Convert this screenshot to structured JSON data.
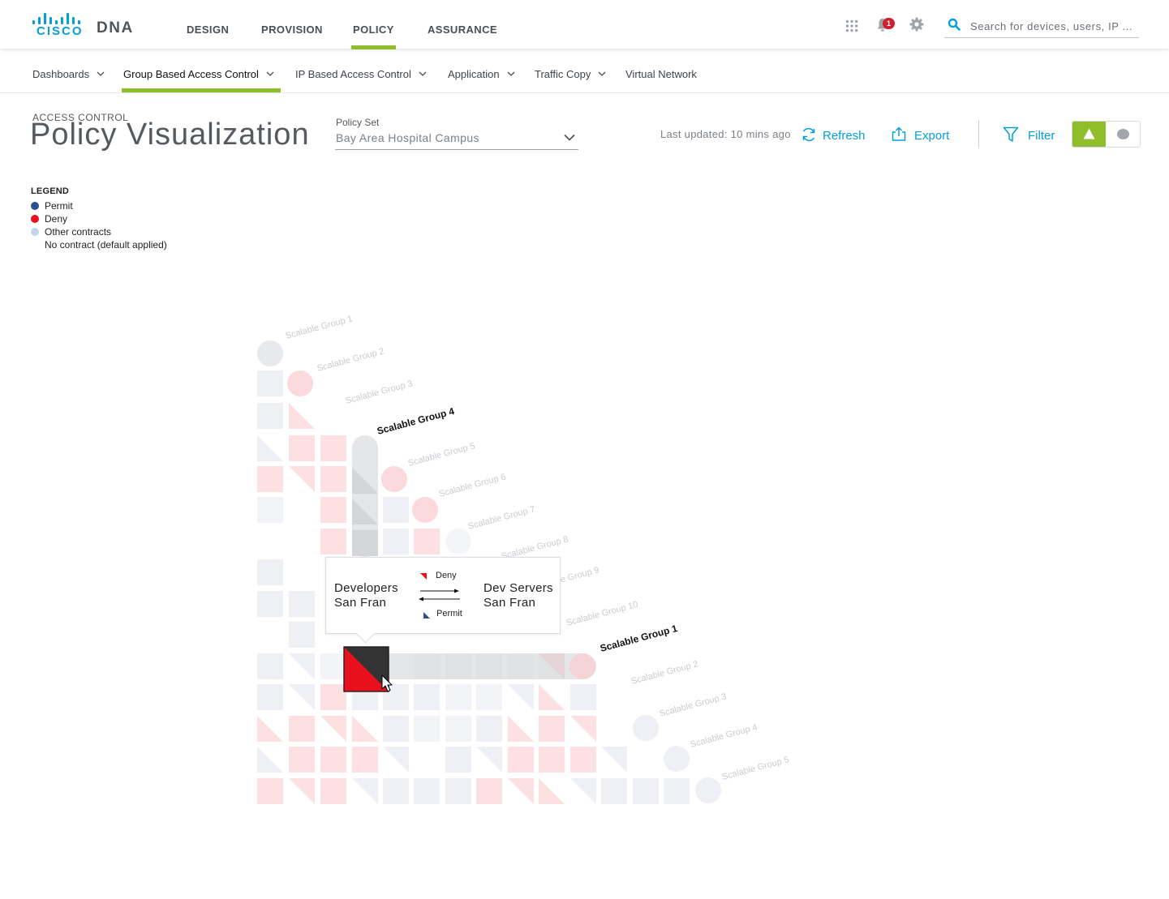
{
  "brand": {
    "logo_text": "CISCO",
    "product": "DNA"
  },
  "main_nav": [
    "DESIGN",
    "PROVISION",
    "POLICY",
    "ASSURANCE"
  ],
  "main_nav_active": "POLICY",
  "notifications": {
    "count": "1"
  },
  "search": {
    "placeholder": "Search for devices, users, IP ..."
  },
  "sub_nav": [
    {
      "label": "Dashboards",
      "has_menu": true
    },
    {
      "label": "Group Based Access Control",
      "has_menu": true,
      "active": true
    },
    {
      "label": "IP Based Access Control",
      "has_menu": true
    },
    {
      "label": "Application",
      "has_menu": true
    },
    {
      "label": "Traffic Copy",
      "has_menu": true
    },
    {
      "label": "Virtual Network",
      "has_menu": false
    }
  ],
  "header": {
    "eyebrow": "ACCESS CONTROL",
    "title": "Policy Visualization",
    "policy_set_label": "Policy Set",
    "policy_set_value": "Bay Area Hospital Campus",
    "last_updated": "Last updated: 10 mins ago",
    "refresh_label": "Refresh",
    "export_label": "Export",
    "filter_label": "Filter"
  },
  "legend": {
    "title": "LEGEND",
    "items": [
      {
        "label": "Permit",
        "color": "#2b4f8f"
      },
      {
        "label": "Deny",
        "color": "#e8101b"
      },
      {
        "label": "Other contracts",
        "color": "#c4d6ea"
      },
      {
        "label": "No contract (default applied)",
        "color": ""
      }
    ]
  },
  "colors": {
    "accent": "#8fbe2a",
    "link": "#049fd9",
    "deny": "#e8101b",
    "deny_light": "#fce0e2",
    "permit_light": "#eef0f6",
    "cell_gray": "#e9eaec",
    "selected": "#333333"
  },
  "matrix": {
    "top_groups": [
      "Scalable Group 1",
      "Scalable Group 2",
      "Scalable Group 3",
      "Scalable Group 4",
      "Scalable Group 5",
      "Scalable Group 6",
      "Scalable Group 7",
      "Scalable Group 8",
      "Scalable Group 9",
      "Scalable Group 10"
    ],
    "bottom_groups": [
      "Scalable Group 1",
      "Scalable Group 2",
      "Scalable Group 3",
      "Scalable Group 4",
      "Scalable Group 5"
    ],
    "highlighted_top": "Scalable Group 4",
    "highlighted_bottom": "Scalable Group 1"
  },
  "tooltip": {
    "source": [
      "Developers",
      "San Fran"
    ],
    "destination": [
      "Dev Servers",
      "San Fran"
    ],
    "forward_label": "Deny",
    "reverse_label": "Permit"
  }
}
